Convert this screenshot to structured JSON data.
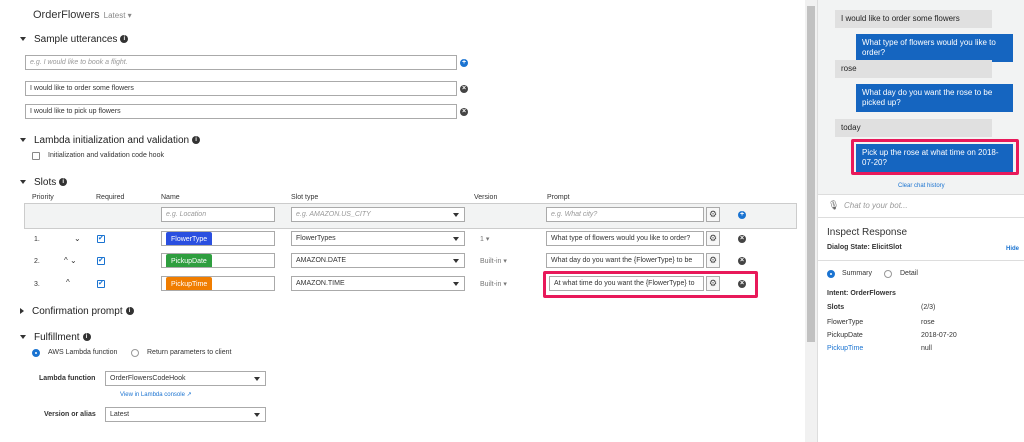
{
  "bot": {
    "name": "OrderFlowers",
    "version": "Latest"
  },
  "sections": {
    "sample_utterances": "Sample utterances",
    "lambda_init": "Lambda initialization and validation",
    "lambda_hook_label": "Initialization and validation code hook",
    "slots": "Slots",
    "confirmation": "Confirmation prompt",
    "fulfillment": "Fulfillment"
  },
  "utterances": {
    "placeholder": "e.g. I would like to book a flight.",
    "items": [
      "I would like to order some flowers",
      "I would like to pick up flowers"
    ]
  },
  "slot_headers": {
    "priority": "Priority",
    "required": "Required",
    "name": "Name",
    "slot_type": "Slot type",
    "version": "Version",
    "prompt": "Prompt"
  },
  "slot_new": {
    "name_placeholder": "e.g. Location",
    "type_placeholder": "e.g. AMAZON.US_CITY",
    "prompt_placeholder": "e.g. What city?"
  },
  "slots": [
    {
      "priority": "1.",
      "name": "FlowerType",
      "color": "#2a4fe0",
      "type": "FlowerTypes",
      "version": "1",
      "prompt": "What type of flowers would you like to order?"
    },
    {
      "priority": "2.",
      "name": "PickupDate",
      "color": "#2e9e3f",
      "type": "AMAZON.DATE",
      "version": "Built-in",
      "prompt": "What day do you want the {FlowerType} to be"
    },
    {
      "priority": "3.",
      "name": "PickupTime",
      "color": "#f07d00",
      "type": "AMAZON.TIME",
      "version": "Built-in",
      "prompt": "At what time do you want the {FlowerType} to"
    }
  ],
  "fulfillment": {
    "option_lambda": "AWS Lambda function",
    "option_return": "Return parameters to client",
    "lambda_label": "Lambda function",
    "lambda_value": "OrderFlowersCodeHook",
    "console_link": "View in Lambda console",
    "alias_label": "Version or alias",
    "alias_value": "Latest"
  },
  "chat": {
    "messages": [
      {
        "from": "user",
        "text": "I would like to order some flowers"
      },
      {
        "from": "bot",
        "text": "What type of flowers would you like to order?"
      },
      {
        "from": "user",
        "text": "rose"
      },
      {
        "from": "bot",
        "text": "What day do you want the rose to be picked up?"
      },
      {
        "from": "user",
        "text": "today"
      },
      {
        "from": "bot",
        "text": "Pick up the rose at what time on 2018-07-20?"
      }
    ],
    "clear": "Clear chat history",
    "placeholder": "Chat to your bot..."
  },
  "inspect": {
    "title": "Inspect Response",
    "dialog_state": "Dialog State: ElicitSlot",
    "hide": "Hide",
    "tab_summary": "Summary",
    "tab_detail": "Detail",
    "intent": "Intent: OrderFlowers",
    "slots_label": "Slots",
    "slots_count": "(2/3)",
    "rows": [
      {
        "name": "FlowerType",
        "value": "rose"
      },
      {
        "name": "PickupDate",
        "value": "2018-07-20"
      },
      {
        "name": "PickupTime",
        "value": "null"
      }
    ]
  },
  "colors": {
    "accent": "#1a73d1",
    "highlight": "#e8195a",
    "bot_bubble": "#1565c0"
  }
}
